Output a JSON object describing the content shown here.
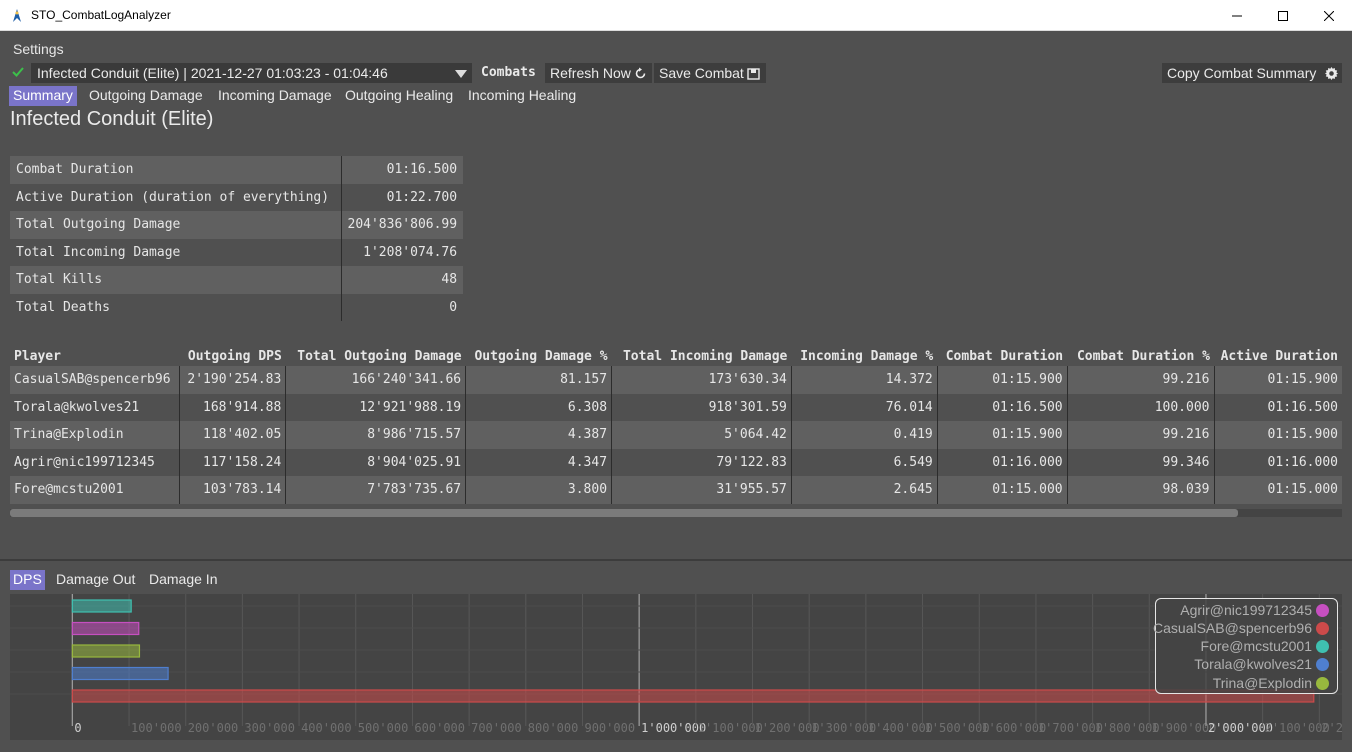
{
  "window": {
    "title": "STO_CombatLogAnalyzer"
  },
  "menu": {
    "settings": "Settings"
  },
  "toolbar": {
    "combat_selection": "Infected Conduit (Elite) | 2021-12-27 01:03:23 - 01:04:46",
    "combats_label": "Combats",
    "refresh_label": "Refresh Now",
    "save_label": "Save Combat",
    "copy_summary_label": "Copy Combat Summary"
  },
  "tabs": [
    {
      "label": "Summary",
      "active": true
    },
    {
      "label": "Outgoing Damage",
      "active": false
    },
    {
      "label": "Incoming Damage",
      "active": false
    },
    {
      "label": "Outgoing Healing",
      "active": false
    },
    {
      "label": "Incoming Healing",
      "active": false
    }
  ],
  "page_title": "Infected Conduit (Elite)",
  "summary": [
    {
      "label": "Combat Duration",
      "value": "01:16.500"
    },
    {
      "label": "Active Duration (duration of everything)",
      "value": "01:22.700"
    },
    {
      "label": "Total Outgoing Damage",
      "value": "204'836'806.99"
    },
    {
      "label": "Total Incoming Damage",
      "value": "1'208'074.76"
    },
    {
      "label": "Total Kills",
      "value": "48"
    },
    {
      "label": "Total Deaths",
      "value": "0"
    }
  ],
  "players": {
    "headers": [
      "Player",
      "Outgoing DPS",
      "Total Outgoing Damage",
      "Outgoing Damage %",
      "Total Incoming Damage",
      "Incoming Damage %",
      "Combat Duration",
      "Combat Duration %",
      "Active Duration"
    ],
    "rows": [
      [
        "CasualSAB@spencerb96",
        "2'190'254.83",
        "166'240'341.66",
        "81.157",
        "173'630.34",
        "14.372",
        "01:15.900",
        "99.216",
        "01:15.900"
      ],
      [
        "Torala@kwolves21",
        "168'914.88",
        "12'921'988.19",
        "6.308",
        "918'301.59",
        "76.014",
        "01:16.500",
        "100.000",
        "01:16.500"
      ],
      [
        "Trina@Explodin",
        "118'402.05",
        "8'986'715.57",
        "4.387",
        "5'064.42",
        "0.419",
        "01:15.900",
        "99.216",
        "01:15.900"
      ],
      [
        "Agrir@nic199712345",
        "117'158.24",
        "8'904'025.91",
        "4.347",
        "79'122.83",
        "6.549",
        "01:16.000",
        "99.346",
        "01:16.000"
      ],
      [
        "Fore@mcstu2001",
        "103'783.14",
        "7'783'735.67",
        "3.800",
        "31'955.57",
        "2.645",
        "01:15.000",
        "98.039",
        "01:15.000"
      ]
    ]
  },
  "graph_tabs": [
    {
      "label": "DPS",
      "active": true
    },
    {
      "label": "Damage Out",
      "active": false
    },
    {
      "label": "Damage In",
      "active": false
    }
  ],
  "chart_data": {
    "type": "bar",
    "orientation": "horizontal",
    "series": [
      {
        "name": "Fore@mcstu2001",
        "value": 103783.14,
        "color": "#3fc0b0"
      },
      {
        "name": "Agrir@nic199712345",
        "value": 117158.24,
        "color": "#c64fc0"
      },
      {
        "name": "Trina@Explodin",
        "value": 118402.05,
        "color": "#98b83e"
      },
      {
        "name": "Torala@kwolves21",
        "value": 168914.88,
        "color": "#4f7fcf"
      },
      {
        "name": "CasualSAB@spencerb96",
        "value": 2190254.83,
        "color": "#cc4a4a"
      }
    ],
    "x_tick_labels": [
      "0",
      "100'000",
      "200'000",
      "300'000",
      "400'000",
      "500'000",
      "600'000",
      "700'000",
      "800'000",
      "900'000",
      "1'000'000",
      "1'100'000",
      "1'200'000",
      "1'300'000",
      "1'400'000",
      "1'500'000",
      "1'600'000",
      "1'700'000",
      "1'800'000",
      "1'900'000",
      "2'000'000",
      "2'100'000",
      "2'200'000"
    ],
    "xlim": [
      -110000,
      2240000
    ],
    "grid": true,
    "legend_position": "top-right",
    "legend": [
      {
        "name": "Agrir@nic199712345",
        "color": "#c64fc0"
      },
      {
        "name": "CasualSAB@spencerb96",
        "color": "#cc4a4a"
      },
      {
        "name": "Fore@mcstu2001",
        "color": "#3fc0b0"
      },
      {
        "name": "Torala@kwolves21",
        "color": "#4f7fcf"
      },
      {
        "name": "Trina@Explodin",
        "color": "#98b83e"
      }
    ]
  },
  "colors": {
    "accent": "#7a74c9",
    "background": "#505050",
    "row_alt": "#606060"
  }
}
